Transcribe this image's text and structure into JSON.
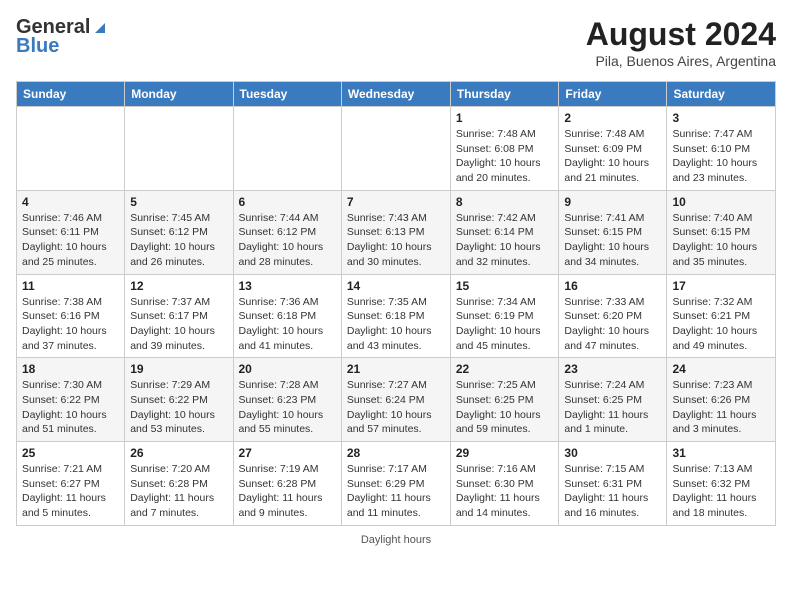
{
  "header": {
    "logo_general": "General",
    "logo_blue": "Blue",
    "month_year": "August 2024",
    "location": "Pila, Buenos Aires, Argentina"
  },
  "days_of_week": [
    "Sunday",
    "Monday",
    "Tuesday",
    "Wednesday",
    "Thursday",
    "Friday",
    "Saturday"
  ],
  "weeks": [
    [
      {
        "day": "",
        "info": ""
      },
      {
        "day": "",
        "info": ""
      },
      {
        "day": "",
        "info": ""
      },
      {
        "day": "",
        "info": ""
      },
      {
        "day": "1",
        "info": "Sunrise: 7:48 AM\nSunset: 6:08 PM\nDaylight: 10 hours and 20 minutes."
      },
      {
        "day": "2",
        "info": "Sunrise: 7:48 AM\nSunset: 6:09 PM\nDaylight: 10 hours and 21 minutes."
      },
      {
        "day": "3",
        "info": "Sunrise: 7:47 AM\nSunset: 6:10 PM\nDaylight: 10 hours and 23 minutes."
      }
    ],
    [
      {
        "day": "4",
        "info": "Sunrise: 7:46 AM\nSunset: 6:11 PM\nDaylight: 10 hours and 25 minutes."
      },
      {
        "day": "5",
        "info": "Sunrise: 7:45 AM\nSunset: 6:12 PM\nDaylight: 10 hours and 26 minutes."
      },
      {
        "day": "6",
        "info": "Sunrise: 7:44 AM\nSunset: 6:12 PM\nDaylight: 10 hours and 28 minutes."
      },
      {
        "day": "7",
        "info": "Sunrise: 7:43 AM\nSunset: 6:13 PM\nDaylight: 10 hours and 30 minutes."
      },
      {
        "day": "8",
        "info": "Sunrise: 7:42 AM\nSunset: 6:14 PM\nDaylight: 10 hours and 32 minutes."
      },
      {
        "day": "9",
        "info": "Sunrise: 7:41 AM\nSunset: 6:15 PM\nDaylight: 10 hours and 34 minutes."
      },
      {
        "day": "10",
        "info": "Sunrise: 7:40 AM\nSunset: 6:15 PM\nDaylight: 10 hours and 35 minutes."
      }
    ],
    [
      {
        "day": "11",
        "info": "Sunrise: 7:38 AM\nSunset: 6:16 PM\nDaylight: 10 hours and 37 minutes."
      },
      {
        "day": "12",
        "info": "Sunrise: 7:37 AM\nSunset: 6:17 PM\nDaylight: 10 hours and 39 minutes."
      },
      {
        "day": "13",
        "info": "Sunrise: 7:36 AM\nSunset: 6:18 PM\nDaylight: 10 hours and 41 minutes."
      },
      {
        "day": "14",
        "info": "Sunrise: 7:35 AM\nSunset: 6:18 PM\nDaylight: 10 hours and 43 minutes."
      },
      {
        "day": "15",
        "info": "Sunrise: 7:34 AM\nSunset: 6:19 PM\nDaylight: 10 hours and 45 minutes."
      },
      {
        "day": "16",
        "info": "Sunrise: 7:33 AM\nSunset: 6:20 PM\nDaylight: 10 hours and 47 minutes."
      },
      {
        "day": "17",
        "info": "Sunrise: 7:32 AM\nSunset: 6:21 PM\nDaylight: 10 hours and 49 minutes."
      }
    ],
    [
      {
        "day": "18",
        "info": "Sunrise: 7:30 AM\nSunset: 6:22 PM\nDaylight: 10 hours and 51 minutes."
      },
      {
        "day": "19",
        "info": "Sunrise: 7:29 AM\nSunset: 6:22 PM\nDaylight: 10 hours and 53 minutes."
      },
      {
        "day": "20",
        "info": "Sunrise: 7:28 AM\nSunset: 6:23 PM\nDaylight: 10 hours and 55 minutes."
      },
      {
        "day": "21",
        "info": "Sunrise: 7:27 AM\nSunset: 6:24 PM\nDaylight: 10 hours and 57 minutes."
      },
      {
        "day": "22",
        "info": "Sunrise: 7:25 AM\nSunset: 6:25 PM\nDaylight: 10 hours and 59 minutes."
      },
      {
        "day": "23",
        "info": "Sunrise: 7:24 AM\nSunset: 6:25 PM\nDaylight: 11 hours and 1 minute."
      },
      {
        "day": "24",
        "info": "Sunrise: 7:23 AM\nSunset: 6:26 PM\nDaylight: 11 hours and 3 minutes."
      }
    ],
    [
      {
        "day": "25",
        "info": "Sunrise: 7:21 AM\nSunset: 6:27 PM\nDaylight: 11 hours and 5 minutes."
      },
      {
        "day": "26",
        "info": "Sunrise: 7:20 AM\nSunset: 6:28 PM\nDaylight: 11 hours and 7 minutes."
      },
      {
        "day": "27",
        "info": "Sunrise: 7:19 AM\nSunset: 6:28 PM\nDaylight: 11 hours and 9 minutes."
      },
      {
        "day": "28",
        "info": "Sunrise: 7:17 AM\nSunset: 6:29 PM\nDaylight: 11 hours and 11 minutes."
      },
      {
        "day": "29",
        "info": "Sunrise: 7:16 AM\nSunset: 6:30 PM\nDaylight: 11 hours and 14 minutes."
      },
      {
        "day": "30",
        "info": "Sunrise: 7:15 AM\nSunset: 6:31 PM\nDaylight: 11 hours and 16 minutes."
      },
      {
        "day": "31",
        "info": "Sunrise: 7:13 AM\nSunset: 6:32 PM\nDaylight: 11 hours and 18 minutes."
      }
    ]
  ],
  "footer": {
    "daylight_hours": "Daylight hours"
  }
}
